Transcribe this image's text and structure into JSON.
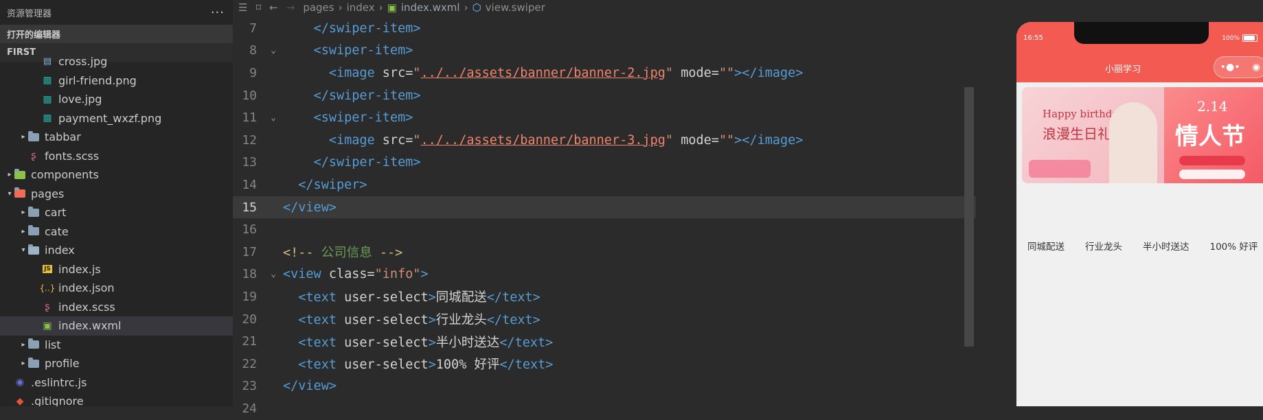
{
  "sidebar": {
    "title": "资源管理器",
    "more": "···",
    "open_editors": "打开的编辑器",
    "project": "FIRST",
    "items": [
      {
        "label": "cross.jpg",
        "depth": 2,
        "kind": "file"
      },
      {
        "label": "girl-friend.png",
        "depth": 2,
        "kind": "image"
      },
      {
        "label": "love.jpg",
        "depth": 2,
        "kind": "image"
      },
      {
        "label": "payment_wxzf.png",
        "depth": 2,
        "kind": "image"
      },
      {
        "label": "tabbar",
        "depth": 1,
        "kind": "folder",
        "caret": "▸"
      },
      {
        "label": "fonts.scss",
        "depth": 1,
        "kind": "scss"
      },
      {
        "label": "components",
        "depth": 0,
        "kind": "folder-green",
        "caret": "▸"
      },
      {
        "label": "pages",
        "depth": 0,
        "kind": "folder-red-open",
        "caret": "▾"
      },
      {
        "label": "cart",
        "depth": 1,
        "kind": "folder",
        "caret": "▸"
      },
      {
        "label": "cate",
        "depth": 1,
        "kind": "folder",
        "caret": "▸"
      },
      {
        "label": "index",
        "depth": 1,
        "kind": "folder-open",
        "caret": "▾"
      },
      {
        "label": "index.js",
        "depth": 2,
        "kind": "js"
      },
      {
        "label": "index.json",
        "depth": 2,
        "kind": "json"
      },
      {
        "label": "index.scss",
        "depth": 2,
        "kind": "scss"
      },
      {
        "label": "index.wxml",
        "depth": 2,
        "kind": "wxml",
        "selected": true
      },
      {
        "label": "list",
        "depth": 1,
        "kind": "folder",
        "caret": "▸"
      },
      {
        "label": "profile",
        "depth": 1,
        "kind": "folder",
        "caret": "▸"
      },
      {
        "label": ".eslintrc.js",
        "depth": 0,
        "kind": "eslint"
      },
      {
        "label": ".gitignore",
        "depth": 0,
        "kind": "git"
      }
    ]
  },
  "breadcrumb": {
    "pages": "pages",
    "index": "index",
    "file": "index.wxml",
    "symbol": "view.swiper"
  },
  "code": {
    "lines": [
      {
        "n": "7",
        "fold": ""
      },
      {
        "n": "8",
        "fold": "⌄"
      },
      {
        "n": "9",
        "fold": ""
      },
      {
        "n": "10",
        "fold": ""
      },
      {
        "n": "11",
        "fold": "⌄"
      },
      {
        "n": "12",
        "fold": ""
      },
      {
        "n": "13",
        "fold": ""
      },
      {
        "n": "14",
        "fold": ""
      },
      {
        "n": "15",
        "fold": "",
        "current": true
      },
      {
        "n": "16",
        "fold": ""
      },
      {
        "n": "17",
        "fold": ""
      },
      {
        "n": "18",
        "fold": "⌄"
      },
      {
        "n": "19",
        "fold": ""
      },
      {
        "n": "20",
        "fold": ""
      },
      {
        "n": "21",
        "fold": ""
      },
      {
        "n": "22",
        "fold": ""
      },
      {
        "n": "23",
        "fold": ""
      },
      {
        "n": "24",
        "fold": ""
      }
    ],
    "banner2_src": "../../assets/banner/banner-2.jpg",
    "banner3_src": "../../assets/banner/banner-3.jpg",
    "comment": "公司信息",
    "info_class": "info",
    "info_items": [
      "同城配送",
      "行业龙头",
      "半小时送达",
      "100% 好评"
    ]
  },
  "phone": {
    "time": "16:55",
    "battery": "100%",
    "nav_title": "小丽学习",
    "banner1_en": "Happy birthday",
    "banner1_cn": "浪漫生日礼",
    "banner2_date": "2.14",
    "banner2_cn": "情人节",
    "info_items": [
      "同城配送",
      "行业龙头",
      "半小时送达",
      "100% 好评"
    ]
  },
  "colors": {
    "nav_red": "#f25a52",
    "tag_blue": "#569cd6",
    "string_orange": "#ce9178"
  }
}
